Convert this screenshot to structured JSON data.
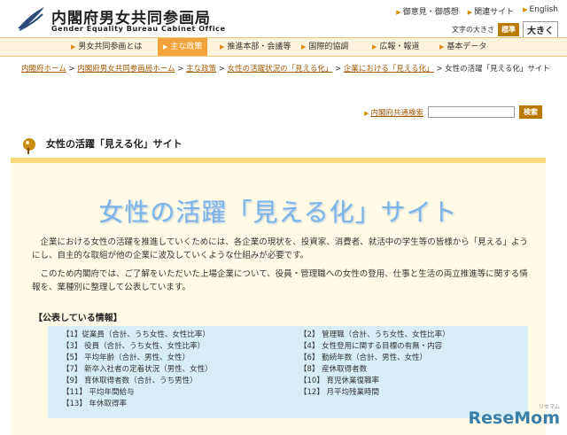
{
  "header": {
    "title": "内閣府男女共同参画局",
    "subtitle": "Gender Equality Bureau Cabinet Office",
    "util_links": [
      "御意見・御感想",
      "関連サイト",
      "English"
    ],
    "font_size_label": "文字の大きさ",
    "font_size_standard": "標準",
    "font_size_large": "大きく"
  },
  "nav": {
    "items": [
      "男女共同参画とは",
      "主な政策",
      "推進本部・会議等",
      "国際的協調",
      "広報・報道",
      "基本データ"
    ],
    "active_index": 1
  },
  "breadcrumb": {
    "links": [
      "内閣府ホーム",
      "内閣府男女共同参画局ホーム",
      "主な政策",
      "女性の活躍状況の「見える化」",
      "企業における「見える化」"
    ],
    "current": "女性の活躍「見える化」サイト",
    "separator": ">"
  },
  "search": {
    "label": "内閣府共通検索",
    "button": "検索",
    "placeholder": ""
  },
  "main": {
    "heading": "女性の活躍「見える化」サイト",
    "hero": "女性の活躍「見える化」サイト",
    "paragraph1": "企業における女性の活躍を推進していくためには、各企業の現状を、投資家、消費者、就活中の学生等の皆様から「見える」ようにし、自主的な取組が他の企業に波及していくような仕組みが必要です。",
    "paragraph2": "このため内閣府では、ご了解をいただいた上場企業について、役員・管理職への女性の登用、仕事と生活の両立推進等に関する情報を、業種別に整理して公表しています。",
    "info_title": "【公表している情報】",
    "info_left": [
      "【1】従業員（合計、うち女性、女性比率）",
      "【3】 役員（合計、うち女性、女性比率）",
      "【5】 平均年齢（合計、男性、女性）",
      "【7】 新卒入社者の定着状況（男性、女性）",
      "【9】 育休取得者数（合計、うち男性）",
      "【11】 平均年間給与",
      "【13】 年休取得率"
    ],
    "info_right": [
      "【2】 管理職（合計、うち女性、女性比率）",
      "【4】 女性登用に関する目標の有無・内容",
      "【6】 勤続年数（合計、男性、女性）",
      "【8】 産休取得者数",
      "【10】 育児休業復職率",
      "【12】 月平均残業時間"
    ]
  },
  "watermark": {
    "text": "ReseMom",
    "small": "リセマム"
  },
  "colors": {
    "accent": "#f3a33b",
    "nav_bg": "#fdf3dc",
    "section_rule": "#fbd977",
    "panel_bg": "#fffbe6",
    "table_bg": "#d8eef6",
    "hero_text": "#7db4e8",
    "link": "#a35a00"
  }
}
